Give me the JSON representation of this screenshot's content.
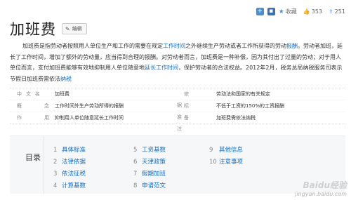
{
  "topbar": {
    "collect_label": "收藏",
    "like_count": "353",
    "share_count": "251"
  },
  "title": "加班费",
  "edit_label": "编辑",
  "intro": {
    "p1": "加班费是指劳动者按照用人单位生产和工作的需要在规定",
    "link1": "工作时间",
    "p2": "之外继续生产劳动或者工作所获得的劳动",
    "link2": "报酬",
    "p3": "。劳动者加班，延长了工作时间，增加了额外的劳动量，应当得到合理的报酬。对劳动者而言，加班费是一种补偿，因为其付出了过量的劳动；对于用人单位而言，支付加班费能够有效地抑制用人单位随意地",
    "link3": "延长工作时间",
    "p4": "，保护劳动者的合法权益。2012年2月，税务总局纳税服务司表示节假日加班费需依法",
    "link4": "纳税"
  },
  "infobox": [
    {
      "k": "中文名",
      "v": "加班费",
      "k2": "依　　据",
      "v2": "劳动法和国家的有关规定"
    },
    {
      "k": "概　　念",
      "v": "工作时间外生产劳动所得的报酬",
      "k2": "标　　准",
      "v2": "不低于工资的150%的工资报酬"
    },
    {
      "k": "作　　用",
      "v": "抑制用人单位随意延长工作时间",
      "k2": "备　　注",
      "v2": "加班费需依法纳税"
    }
  ],
  "toc": {
    "label": "目录",
    "col1": [
      {
        "n": "1",
        "t": "具体标准"
      },
      {
        "n": "2",
        "t": "法律依据"
      },
      {
        "n": "3",
        "t": "依法征税"
      },
      {
        "n": "4",
        "t": "计算基数"
      }
    ],
    "col2": [
      {
        "n": "5",
        "t": "工资基数"
      },
      {
        "n": "6",
        "t": "天津政策"
      },
      {
        "n": "7",
        "t": "假期加班"
      },
      {
        "n": "8",
        "t": "申请范文"
      }
    ],
    "col3": [
      {
        "n": "9",
        "t": "其他信息"
      },
      {
        "n": "10",
        "t": "注意事项"
      }
    ]
  },
  "watermark": {
    "line1": "Baidu经验",
    "line2": "jingyan.baidu.com"
  }
}
